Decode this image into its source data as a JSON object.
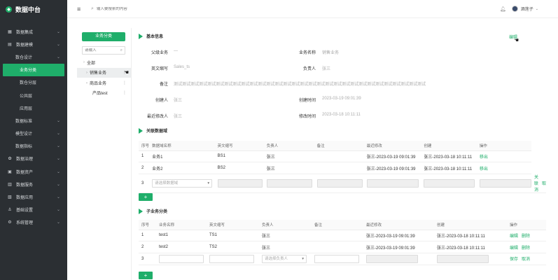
{
  "app": {
    "title": "数据中台",
    "logo_glyph": "◆"
  },
  "header": {
    "search_placeholder": "输入要搜索的内容",
    "user": "酒莲子"
  },
  "sidebar": {
    "items": [
      {
        "label": "数据集成",
        "icon": "▦",
        "level": 0
      },
      {
        "label": "数据建模",
        "icon": "▤",
        "level": 0
      },
      {
        "label": "数仓设计",
        "level": 1
      },
      {
        "label": "业务分类",
        "level": 2,
        "active": true
      },
      {
        "label": "数仓分层",
        "level": 2
      },
      {
        "label": "公共层",
        "level": 2
      },
      {
        "label": "应用层",
        "level": 2
      },
      {
        "label": "数据标准",
        "level": 1
      },
      {
        "label": "模型设计",
        "level": 1
      },
      {
        "label": "数据指标",
        "level": 1
      },
      {
        "label": "数据治理",
        "icon": "✿",
        "level": 0
      },
      {
        "label": "数据资产",
        "icon": "▣",
        "level": 0
      },
      {
        "label": "数据服务",
        "icon": "▥",
        "level": 0
      },
      {
        "label": "数据应用",
        "icon": "▧",
        "level": 0
      },
      {
        "label": "基础设置",
        "icon": "⚓",
        "level": 0
      },
      {
        "label": "系统管理",
        "icon": "⚙",
        "level": 0
      }
    ]
  },
  "tree": {
    "button": "业务分类",
    "search_placeholder": "请输入",
    "nodes": [
      {
        "label": "全部",
        "toggle": "›",
        "indent": 0
      },
      {
        "label": "销售业务",
        "toggle": "›",
        "indent": 1,
        "selected": true,
        "more": "⋮"
      },
      {
        "label": "商品业务",
        "toggle": "⌄",
        "indent": 1,
        "more": "⋮"
      },
      {
        "label": "产品test",
        "toggle": "",
        "indent": 2,
        "more": "⋮"
      }
    ]
  },
  "basic": {
    "title": "基本信息",
    "edit": "编辑",
    "fields": {
      "parent_label": "父级业务",
      "parent_value": "—",
      "name_label": "业务名称",
      "name_value": "销售业务",
      "en_label": "英文缩写",
      "en_value": "Sales_ts",
      "owner_label": "负责人",
      "owner_value": "张三",
      "remark_label": "备注",
      "remark_value": "测试测试测试测试测试测试测试测试测试测试测试测试测试测试测试测试测试测试测试测试测试测试测试测试测试测试测试测试测试测试",
      "creator_label": "创建人",
      "creator_value": "张三",
      "ctime_label": "创建时间",
      "ctime_value": "2023-03-19 09:01:39",
      "modifier_label": "最近修改人",
      "modifier_value": "张三",
      "mtime_label": "修改时间",
      "mtime_value": "2023-03-18 10:11:11"
    }
  },
  "domain_table": {
    "title": "关联数据域",
    "headers": [
      "序号",
      "数据域名称",
      "英文缩写",
      "负责人",
      "备注",
      "最近修改",
      "创建",
      "操作"
    ],
    "rows": [
      {
        "idx": "1",
        "name": "业务1",
        "en": "BS1",
        "owner": "张三",
        "remark": "",
        "modified": "张三-2023-03-19 09:01:39",
        "created": "张三-2023-03-18 10:11:11",
        "action": "移出"
      },
      {
        "idx": "2",
        "name": "业务2",
        "en": "BS2",
        "owner": "张三",
        "remark": "",
        "modified": "张三-2023-03-19 09:01:39",
        "created": "张三-2023-03-18 10:11:11",
        "action": "移出"
      }
    ],
    "new_row": {
      "idx": "3",
      "select_placeholder": "请选择数据域",
      "ok": "关联",
      "cancel": "取消"
    },
    "add": "+"
  },
  "sub_table": {
    "title": "子业务分类",
    "headers": [
      "序号",
      "业务名称",
      "英文缩写",
      "负责人",
      "备注",
      "最近修改",
      "创建",
      "操作"
    ],
    "rows": [
      {
        "idx": "1",
        "name": "test1",
        "en": "TS1",
        "owner": "张三",
        "remark": "",
        "modified": "张三-2023-03-19 09:01:39",
        "created": "张三-2023-03-18 10:11:11",
        "edit": "编辑",
        "del": "删除"
      },
      {
        "idx": "2",
        "name": "test2",
        "en": "TS2",
        "owner": "张三",
        "remark": "",
        "modified": "张三-2023-03-19 09:01:39",
        "created": "张三-2023-03-18 10:11:11",
        "edit": "编辑",
        "del": "删除"
      }
    ],
    "new_row": {
      "idx": "3",
      "owner_placeholder": "请选择负责人",
      "save": "保存",
      "cancel": "取消"
    },
    "add": "+"
  },
  "colors": {
    "accent": "#1fae6a",
    "sidebar_bg": "#2b2f33"
  }
}
